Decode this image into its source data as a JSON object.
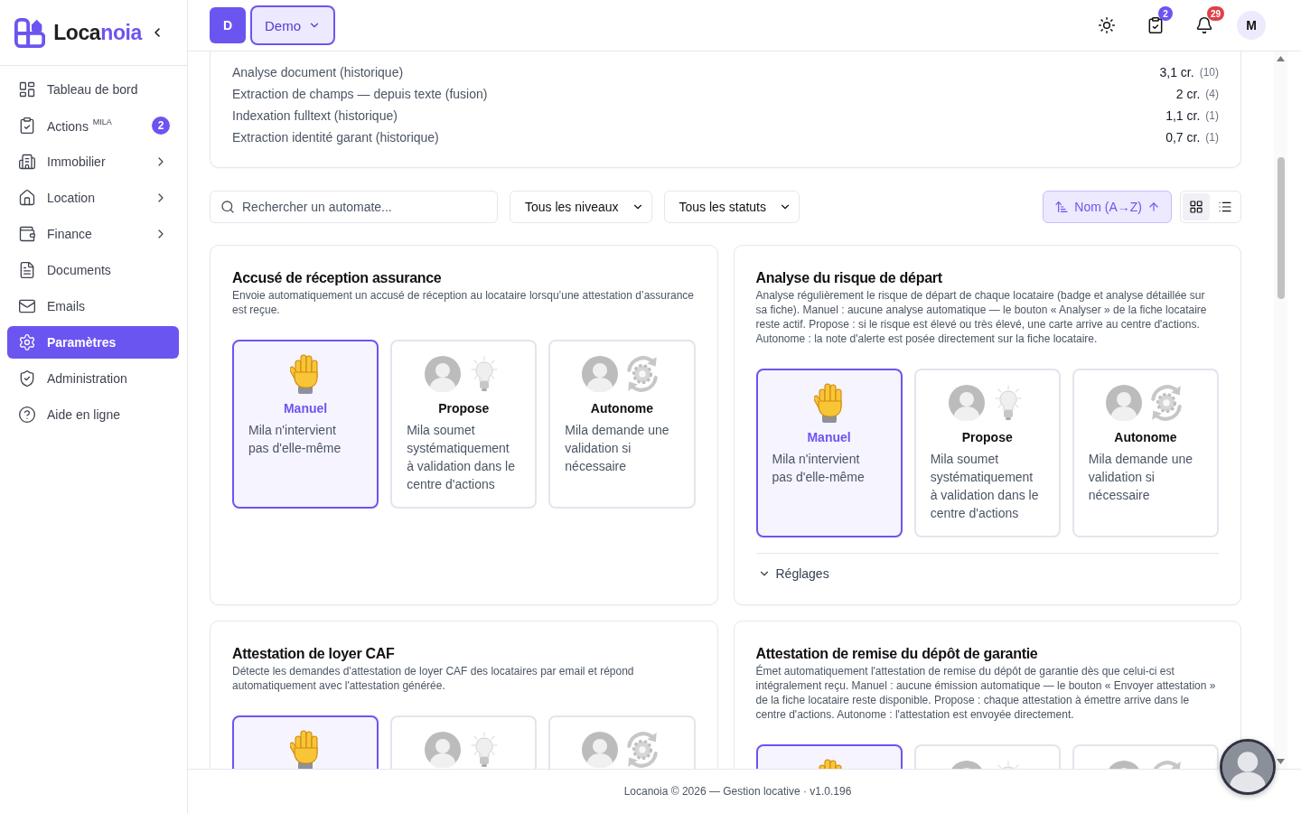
{
  "sidebar": {
    "logo": {
      "parts": [
        "Loca",
        "noia"
      ]
    },
    "items": [
      {
        "label": "Tableau de bord",
        "selected": false,
        "expandable": false
      },
      {
        "label": "Actions $^{MILA}$",
        "selected": false,
        "expandable": false,
        "badge": "2"
      },
      {
        "label": "Immobilier",
        "selected": false,
        "expandable": true
      },
      {
        "label": "Location",
        "selected": false,
        "expandable": true
      },
      {
        "label": "Finance",
        "selected": false,
        "expandable": true
      },
      {
        "label": "Documents",
        "selected": false,
        "expandable": false
      },
      {
        "label": "Emails",
        "selected": false,
        "expandable": false
      },
      {
        "label": "Paramètres",
        "selected": true,
        "expandable": false
      },
      {
        "label": "Administration",
        "selected": false,
        "expandable": false
      },
      {
        "label": "Aide en ligne",
        "selected": false,
        "expandable": false
      }
    ]
  },
  "header": {
    "workspace_initial": "D",
    "workspace": "Demo",
    "actions_badge": "2",
    "notifications_badge": "29",
    "user_initial": "M"
  },
  "usage": {
    "rows": [
      {
        "label": "Analyse document (historique)",
        "credits": "3,1 cr.",
        "count": "(10)"
      },
      {
        "label": "Extraction de champs — depuis texte (fusion)",
        "credits": "2 cr.",
        "count": "(4)"
      },
      {
        "label": "Indexation fulltext (historique)",
        "credits": "1,1 cr.",
        "count": "(1)"
      },
      {
        "label": "Extraction identité garant (historique)",
        "credits": "0,7 cr.",
        "count": "(1)"
      }
    ]
  },
  "filters": {
    "search": {
      "placeholder": "Rechercher un automate..."
    },
    "level_select": "Tous les niveaux",
    "status_select": "Tous les statuts",
    "sort": "Nom (A→Z)",
    "view_options": [
      {
        "kind": "grid",
        "selected": true
      },
      {
        "kind": "list",
        "selected": false
      }
    ]
  },
  "automations": [
    {
      "title": "Accusé de réception assurance",
      "description": "Envoie automatiquement un accusé de réception au locataire lorsqu’une attestation d’assurance est reçue.",
      "modes": [
        {
          "kind": "manual",
          "label": "Manuel",
          "description": "Mila n'intervient pas d'elle-même",
          "selected": true
        },
        {
          "kind": "propose",
          "label": "Propose",
          "description": "Mila soumet systématiquement à validation dans le centre d'actions",
          "selected": false
        },
        {
          "kind": "autonomous",
          "label": "Autonome",
          "description": "Mila demande une validation si nécessaire",
          "selected": false
        }
      ]
    },
    {
      "title": "Analyse du risque de départ",
      "description": "Analyse régulièrement le risque de départ de chaque locataire (badge et analyse détaillée sur sa fiche). Manuel : aucune analyse automatique — le bouton « Analyser » de la fiche locataire reste actif. Propose : si le risque est élevé ou très élevé, une carte arrive au centre d'actions. Autonome : la note d'alerte est posée directement sur la fiche locataire.",
      "modes": [
        {
          "kind": "manual",
          "label": "Manuel",
          "description": "Mila n'intervient pas d'elle-même",
          "selected": true
        },
        {
          "kind": "propose",
          "label": "Propose",
          "description": "Mila soumet systématiquement à validation dans le centre d'actions",
          "selected": false
        },
        {
          "kind": "autonomous",
          "label": "Autonome",
          "description": "Mila demande une validation si nécessaire",
          "selected": false
        }
      ],
      "settings": {
        "label": "Réglages",
        "expanded": false
      }
    },
    {
      "title": "Attestation de loyer CAF",
      "description": "Détecte les demandes d'attestation de loyer CAF des locataires par email et répond automatiquement avec l'attestation générée.",
      "modes": [
        {
          "kind": "manual",
          "selected": true
        },
        {
          "kind": "propose",
          "selected": false
        },
        {
          "kind": "autonomous",
          "selected": false
        }
      ]
    },
    {
      "title": "Attestation de remise du dépôt de garantie",
      "description": "Émet automatiquement l'attestation de remise du dépôt de garantie dès que celui-ci est intégralement reçu. Manuel : aucune émission automatique — le bouton « Envoyer attestation » de la fiche locataire reste disponible. Propose : chaque attestation à émettre arrive dans le centre d'actions. Autonome : l'attestation est envoyée directement.",
      "modes": [
        {
          "kind": "manual",
          "selected": true
        },
        {
          "kind": "propose",
          "selected": false
        },
        {
          "kind": "autonomous",
          "selected": false
        }
      ]
    }
  ],
  "footer": "Locanoia © 2026 — Gestion locative · v1.0.196"
}
